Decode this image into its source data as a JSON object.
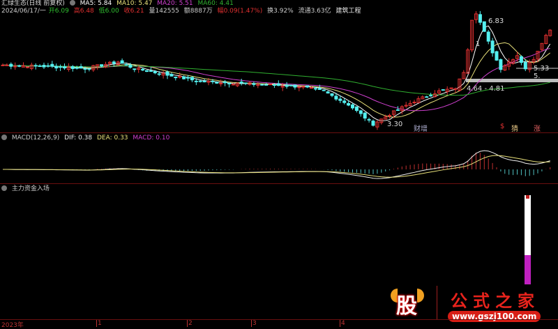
{
  "header": {
    "title": "汇绿生态(日线 前复权)",
    "ma5": "MA5: 5.84",
    "ma10": "MA10: 5.47",
    "ma20": "MA20: 5.51",
    "ma60": "MA60: 4.41",
    "date": "2024/06/17/一",
    "open_label": "开",
    "open": "6.09",
    "high_label": "高",
    "high": "6.48",
    "low_label": "低",
    "low": "6.00",
    "close_label": "收",
    "close": "6.21",
    "volume_label": "量",
    "volume": "142555",
    "amount_label": "额",
    "amount": "8887万",
    "change_label": "幅",
    "change": "0.09(1.47%)",
    "turnover": "换3.92%",
    "float_cap": "流通3.63亿",
    "industry": "建筑工程"
  },
  "colors": {
    "ma5": "#ffffff",
    "ma10": "#e8e07a",
    "ma20": "#d040d0",
    "ma60": "#30b030",
    "up": "#e03030",
    "down": "#54f0f0"
  },
  "annotations": {
    "high": "6.83",
    "low": "3.30",
    "range1": "4.64 - 4.81",
    "range2": "5.33 - 5.",
    "mark1": "1",
    "mark2": "-"
  },
  "signals": [
    "财增",
    "$",
    "猜",
    "涨"
  ],
  "macd": {
    "title": "MACD(12,26,9)",
    "dif": "DIF: 0.38",
    "dea": "DEA: 0.33",
    "macd": "MACD: 0.10"
  },
  "indicator3": {
    "title": "主力资金入场",
    "fill_fraction": 0.33
  },
  "xaxis": [
    "2023年",
    "1",
    "2",
    "3",
    "4"
  ],
  "logo": {
    "icon": "股",
    "name": "公式之家",
    "url": "www.gszj100.com"
  },
  "chart_data": {
    "type": "candlestick",
    "price_keypoints": [
      [
        0,
        5.1
      ],
      [
        12,
        5.05
      ],
      [
        20,
        5.0
      ],
      [
        28,
        5.2
      ],
      [
        32,
        5.0
      ],
      [
        40,
        4.8
      ],
      [
        48,
        4.6
      ],
      [
        56,
        4.55
      ],
      [
        64,
        4.5
      ],
      [
        72,
        4.45
      ],
      [
        78,
        4.3
      ],
      [
        84,
        3.9
      ],
      [
        88,
        3.5
      ],
      [
        90,
        3.3
      ],
      [
        94,
        3.6
      ],
      [
        100,
        4.0
      ],
      [
        106,
        4.3
      ],
      [
        110,
        4.4
      ],
      [
        112,
        4.9
      ],
      [
        113,
        5.6
      ],
      [
        114,
        6.5
      ],
      [
        115,
        6.7
      ],
      [
        117,
        6.1
      ],
      [
        119,
        5.5
      ],
      [
        121,
        5.0
      ],
      [
        123,
        5.2
      ],
      [
        125,
        5.4
      ],
      [
        127,
        5.0
      ],
      [
        129,
        5.3
      ],
      [
        131,
        5.8
      ],
      [
        133,
        6.2
      ]
    ]
  }
}
